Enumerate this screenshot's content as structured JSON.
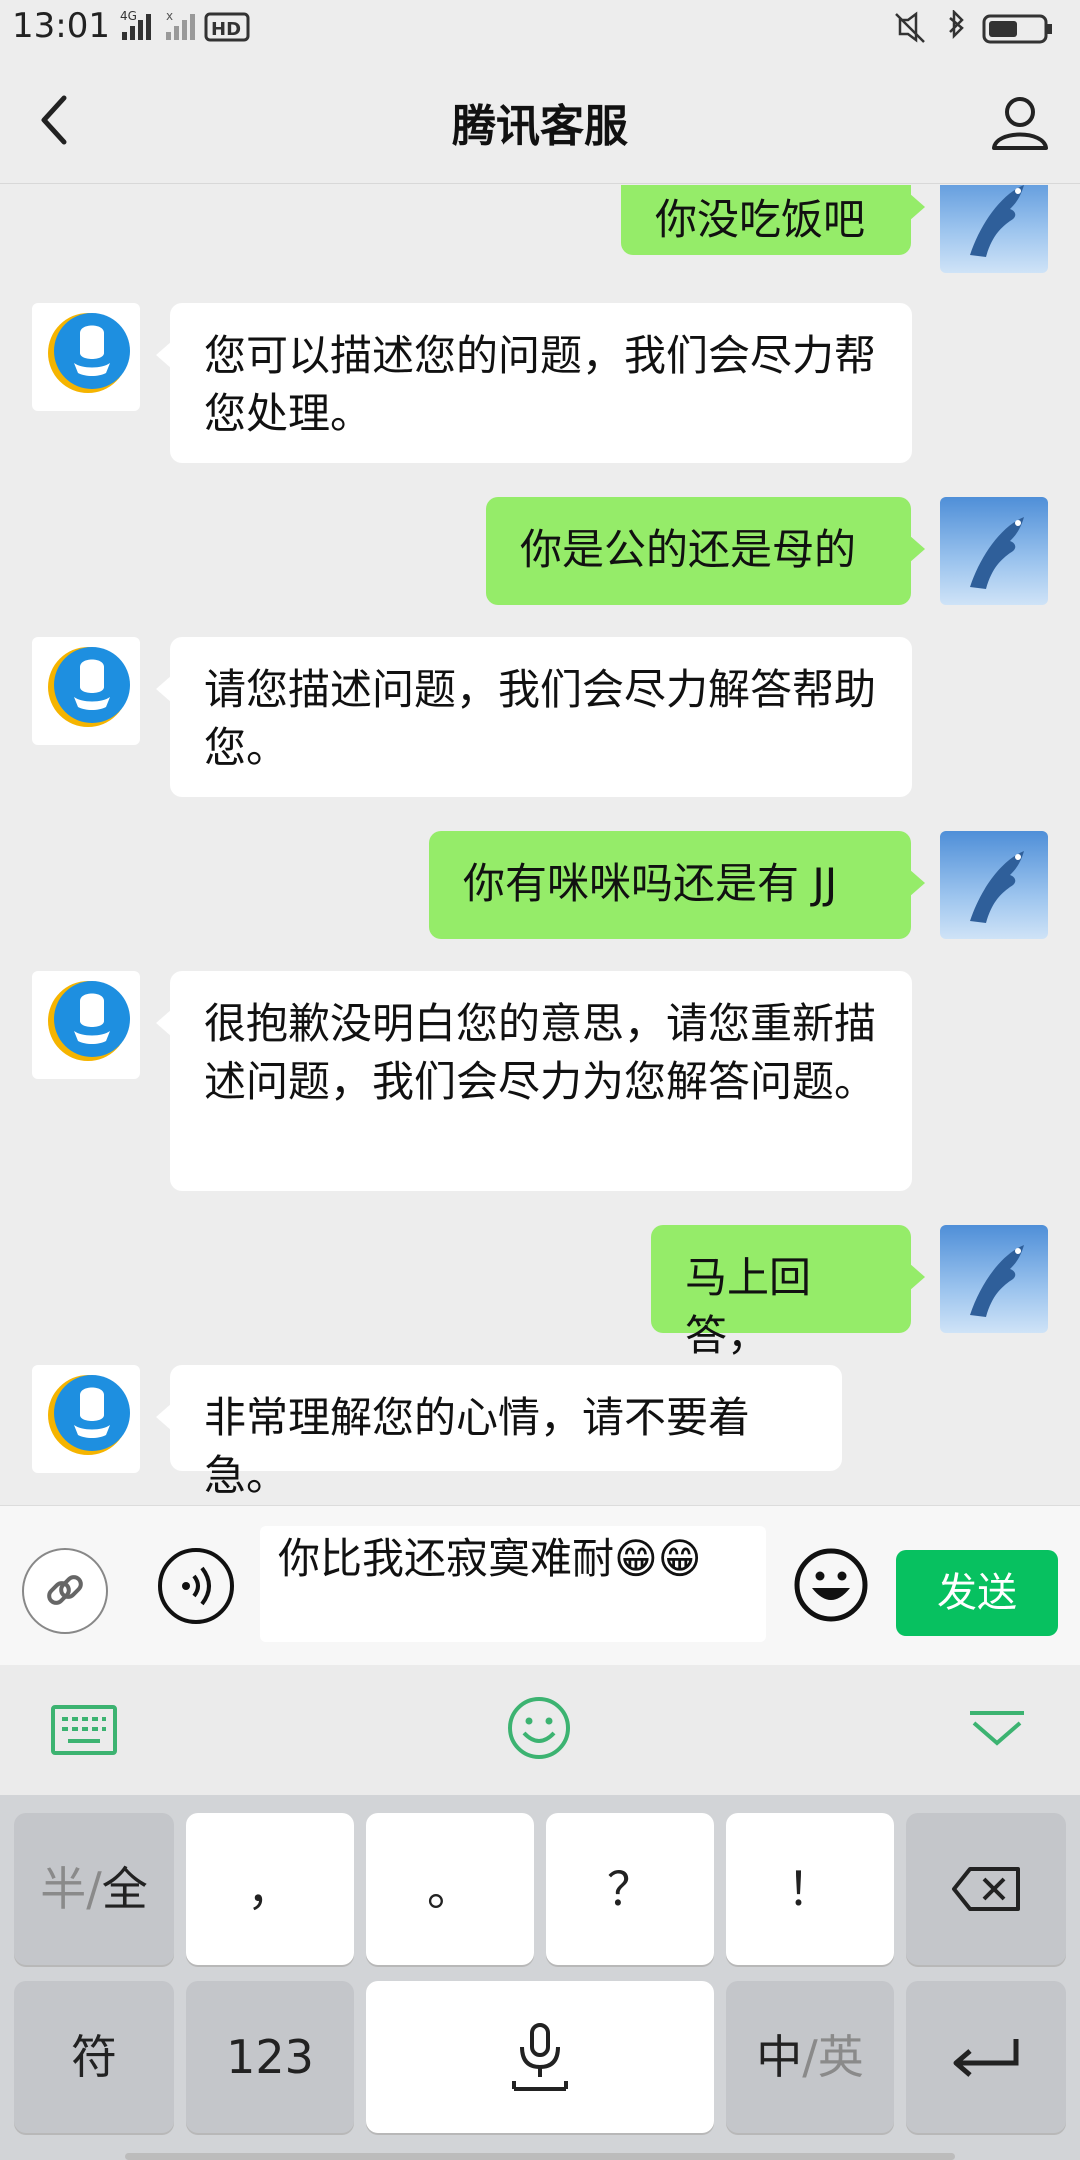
{
  "status": {
    "time": "13:01",
    "net1": "4G",
    "hd": "HD"
  },
  "header": {
    "title": "腾讯客服"
  },
  "messages": [
    {
      "from": "me",
      "text": "你没吃饭吧"
    },
    {
      "from": "cs",
      "text": "您可以描述您的问题，我们会尽力帮您处理。"
    },
    {
      "from": "me",
      "text": "你是公的还是母的"
    },
    {
      "from": "cs",
      "text": "请您描述问题，我们会尽力解答帮助您。"
    },
    {
      "from": "me",
      "text": "你有咪咪吗还是有 JJ"
    },
    {
      "from": "cs",
      "text": "很抱歉没明白您的意思，请您重新描述问题，我们会尽力为您解答问题。"
    },
    {
      "from": "me",
      "text": "马上回答，"
    },
    {
      "from": "cs",
      "text": "非常理解您的心情，请不要着急。"
    }
  ],
  "input": {
    "value": "你比我还寂寞难耐😁😁",
    "send_label": "发送"
  },
  "keyboard": {
    "row1": {
      "k0a": "半",
      "k0sep": "/",
      "k0b": "全",
      "k1": "，",
      "k2": "。",
      "k3": "？",
      "k4": "！"
    },
    "row2": {
      "k0": "符",
      "k1": "123",
      "k3a": "中",
      "k3sep": "/",
      "k3b": "英"
    }
  },
  "colors": {
    "send": "#07c160",
    "my_bubble": "#95ec69",
    "accent_green": "#3cb371"
  }
}
